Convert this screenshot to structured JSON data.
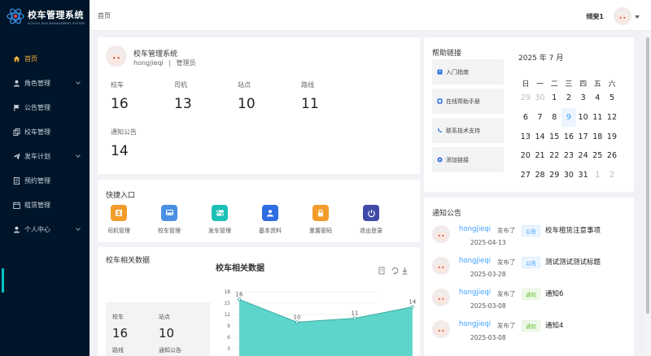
{
  "app": {
    "title": "校车管理系统",
    "subtitle": "SCHOOL BUS MANAGEMENT SYSTEM"
  },
  "sidebar": {
    "items": [
      {
        "label": "首页",
        "icon": "home-icon",
        "active": true
      },
      {
        "label": "角色管理",
        "icon": "user-icon",
        "expandable": true
      },
      {
        "label": "公告管理",
        "icon": "flag-icon"
      },
      {
        "label": "校车管理",
        "icon": "copy-icon"
      },
      {
        "label": "发车计划",
        "icon": "send-icon",
        "expandable": true
      },
      {
        "label": "预约管理",
        "icon": "document-icon"
      },
      {
        "label": "租赁管理",
        "icon": "calendar-icon"
      },
      {
        "label": "个人中心",
        "icon": "user-icon",
        "expandable": true
      }
    ]
  },
  "header": {
    "breadcrumb": "首页",
    "username": "倾斐1"
  },
  "profile": {
    "name": "校车管理系统",
    "account": "hongjieqi",
    "separator": "|",
    "role": "管理员",
    "stats": [
      {
        "label": "校车",
        "value": "16"
      },
      {
        "label": "司机",
        "value": "13"
      },
      {
        "label": "站点",
        "value": "10"
      },
      {
        "label": "路线",
        "value": "11"
      },
      {
        "label": "通知公告",
        "value": "14"
      }
    ]
  },
  "quick": {
    "title": "快捷入口",
    "items": [
      {
        "label": "司机管理",
        "color": "#f39c2b",
        "icon": "driver-icon"
      },
      {
        "label": "校车管理",
        "color": "#4a90e2",
        "icon": "bus-icon"
      },
      {
        "label": "发车管理",
        "color": "#1cc0b5",
        "icon": "toggle-icon"
      },
      {
        "label": "基本资料",
        "color": "#2f6de1",
        "icon": "profile-icon"
      },
      {
        "label": "重置密码",
        "color": "#f39c2b",
        "icon": "lock-icon"
      },
      {
        "label": "退出登录",
        "color": "#3f4aa8",
        "icon": "power-icon"
      }
    ]
  },
  "bus_data": {
    "title": "校车相关数据",
    "mini": [
      {
        "label": "校车",
        "value": "16"
      },
      {
        "label": "站点",
        "value": "10"
      },
      {
        "label": "路线",
        "value": ""
      },
      {
        "label": "通知公告",
        "value": ""
      }
    ]
  },
  "chart_data": {
    "type": "area",
    "title": "校车相关数据",
    "values": [
      16,
      10,
      11,
      14
    ],
    "ylim": [
      0,
      18
    ],
    "yticks": [
      0,
      3,
      6,
      9,
      12,
      15,
      18
    ],
    "color": "#4dd0c4",
    "xlabel": "",
    "ylabel": ""
  },
  "help": {
    "title": "帮助链接",
    "items": [
      {
        "label": "入门指南",
        "icon": "book-icon"
      },
      {
        "label": "在线帮助手册",
        "icon": "manual-icon"
      },
      {
        "label": "联系技术支持",
        "icon": "phone-icon"
      },
      {
        "label": "添加链接",
        "icon": "plus-circle-icon"
      }
    ]
  },
  "calendar": {
    "title": "2025 年 7 月",
    "weekdays": [
      "日",
      "一",
      "二",
      "三",
      "四",
      "五",
      "六"
    ],
    "weeks": [
      [
        {
          "d": "29",
          "m": true
        },
        {
          "d": "30",
          "m": true
        },
        {
          "d": "1"
        },
        {
          "d": "2"
        },
        {
          "d": "3"
        },
        {
          "d": "4"
        },
        {
          "d": "5"
        }
      ],
      [
        {
          "d": "6"
        },
        {
          "d": "7"
        },
        {
          "d": "8"
        },
        {
          "d": "9",
          "t": true
        },
        {
          "d": "10"
        },
        {
          "d": "11"
        },
        {
          "d": "12"
        }
      ],
      [
        {
          "d": "13"
        },
        {
          "d": "14"
        },
        {
          "d": "15"
        },
        {
          "d": "16"
        },
        {
          "d": "17"
        },
        {
          "d": "18"
        },
        {
          "d": "19"
        }
      ],
      [
        {
          "d": "20"
        },
        {
          "d": "21"
        },
        {
          "d": "22"
        },
        {
          "d": "23"
        },
        {
          "d": "24"
        },
        {
          "d": "25"
        },
        {
          "d": "26"
        }
      ],
      [
        {
          "d": "27"
        },
        {
          "d": "28"
        },
        {
          "d": "29"
        },
        {
          "d": "30"
        },
        {
          "d": "31"
        },
        {
          "d": "1",
          "m": true
        },
        {
          "d": "2",
          "m": true
        }
      ]
    ]
  },
  "notices": {
    "title": "通知公告",
    "items": [
      {
        "user": "hongjieqi",
        "action": "发布了",
        "tag": "公告",
        "tag_color": "blue",
        "title": "校车租赁注意事项",
        "date": "2025-04-13"
      },
      {
        "user": "hongjieqi",
        "action": "发布了",
        "tag": "公告",
        "tag_color": "blue",
        "title": "测试测试测试标题",
        "date": "2025-03-28"
      },
      {
        "user": "hongjieqi",
        "action": "发布了",
        "tag": "通知",
        "tag_color": "green",
        "title": "通知6",
        "date": "2025-03-08"
      },
      {
        "user": "hongjieqi",
        "action": "发布了",
        "tag": "通知",
        "tag_color": "green",
        "title": "通知4",
        "date": "2025-03-08"
      }
    ]
  }
}
